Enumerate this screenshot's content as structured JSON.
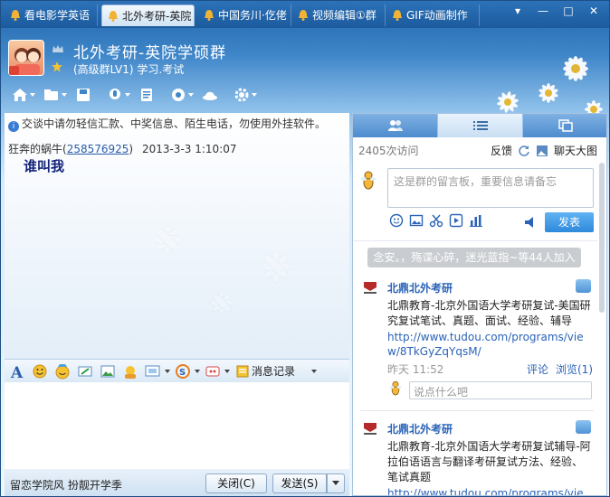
{
  "tabs": [
    {
      "label": "看电影学英语"
    },
    {
      "label": "北外考研-英院"
    },
    {
      "label": "中国务川·仡佬"
    },
    {
      "label": "视频编辑①群"
    },
    {
      "label": "GIF动画制作"
    }
  ],
  "window_buttons": {
    "menu": "▾",
    "minimize": "—",
    "maximize": "□",
    "close": "✕"
  },
  "header": {
    "title": "北外考研-英院学硕群",
    "subtitle": "(高级群LV1) 学习.考试"
  },
  "toolbar_icons": [
    "home-icon",
    "folder-share-icon",
    "save-icon",
    "mic-icon",
    "file-icon",
    "app-icon",
    "hat-icon",
    "gear-icon"
  ],
  "chat": {
    "notice": "交谈中请勿轻信汇款、中奖信息、陌生电话，勿使用外挂软件。",
    "message": {
      "sender": "狂奔的蜗牛",
      "qq_open": "(",
      "qq": "258576925",
      "qq_close": ")",
      "time": "2013-3-3  1:10:07",
      "text": "谁叫我"
    }
  },
  "input_toolbar": {
    "message_record": "消息记录"
  },
  "footer": {
    "signature": "留恋学院风 扮靓开学季",
    "close_button": "关闭(C)",
    "send_button": "发送(S)"
  },
  "right_panel": {
    "visits": "2405次访问",
    "feedback": "反馈",
    "chat_big": "聊天大图",
    "board_placeholder": "这是群的留言板，重要信息请备忘",
    "publish": "发表",
    "banner": "念安。，殇谍心碎，迷光蓝指~等44人加入",
    "posts": [
      {
        "name": "北鼎北外考研",
        "text": "北鼎教育-北京外国语大学考研复试-美国研究复试笔试、真题、面试、经验、辅导",
        "link": "http://www.tudou.com/programs/view/8TkGyZqYqsM/",
        "date": "昨天 11:52",
        "comment": "评论",
        "views": "浏览(1)",
        "reply_placeholder": "说点什么吧"
      },
      {
        "name": "北鼎北外考研",
        "text": "北鼎教育-北京外国语大学考研复试辅导-阿拉伯语语言与翻译考研复试方法、经验、笔试真题",
        "link": "http://www.tudou.com/programs/view/I"
      }
    ]
  },
  "colors": {
    "accent": "#2f89db",
    "link": "#2a63b8",
    "title_bg": "#1f63a8",
    "message": "#13237a"
  }
}
